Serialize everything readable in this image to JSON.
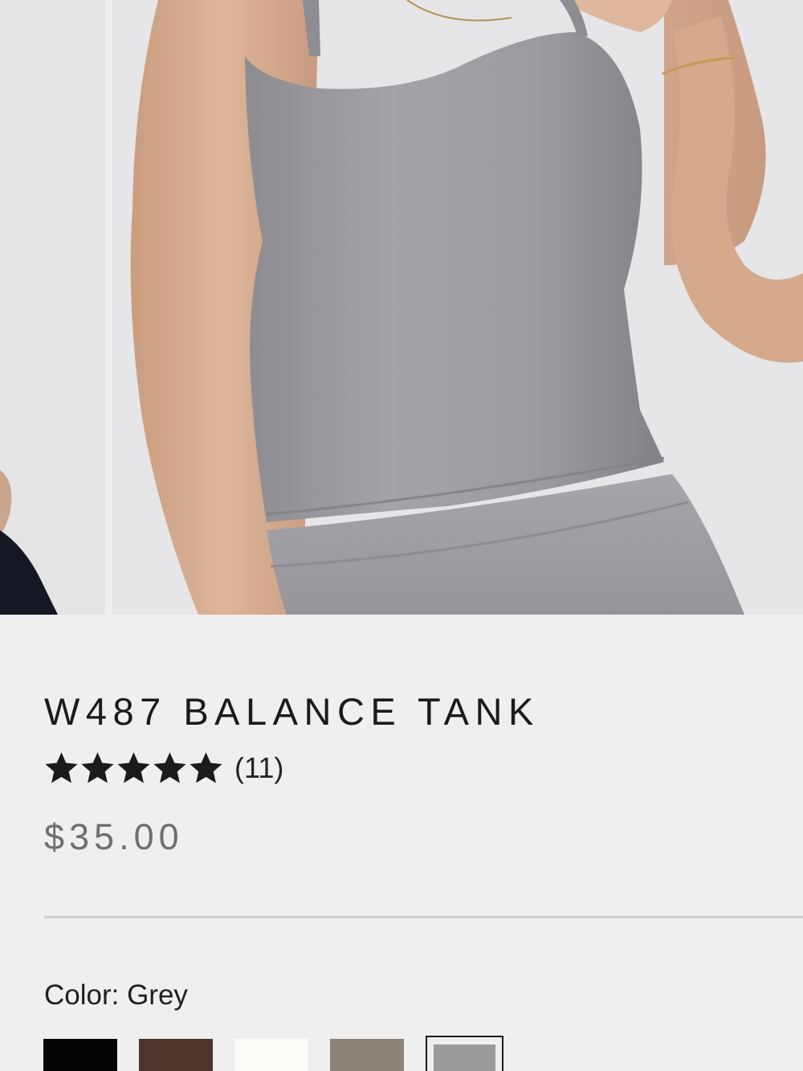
{
  "product": {
    "title": "W487 BALANCE TANK",
    "rating": 5,
    "rating_max": 5,
    "review_count_label": "(11)",
    "price": "$35.00"
  },
  "gallery": {
    "images": [
      {
        "name": "product-image-previous",
        "alt": ""
      },
      {
        "name": "product-image-current",
        "alt": ""
      }
    ]
  },
  "color": {
    "label": "Color: Grey",
    "selected": "Grey",
    "swatches": [
      {
        "name": "Black",
        "hex": "#050505",
        "selected": false
      },
      {
        "name": "Brown",
        "hex": "#4e342a",
        "selected": false
      },
      {
        "name": "White",
        "hex": "#fbfbf7",
        "selected": false
      },
      {
        "name": "Taupe",
        "hex": "#8b8279",
        "selected": false
      },
      {
        "name": "Grey",
        "hex": "#9a9a9a",
        "selected": true
      }
    ]
  },
  "colors": {
    "background": "#efefef",
    "text": "#1b1b1b",
    "price": "#6f6f6f",
    "star": "#1b1b1b"
  }
}
